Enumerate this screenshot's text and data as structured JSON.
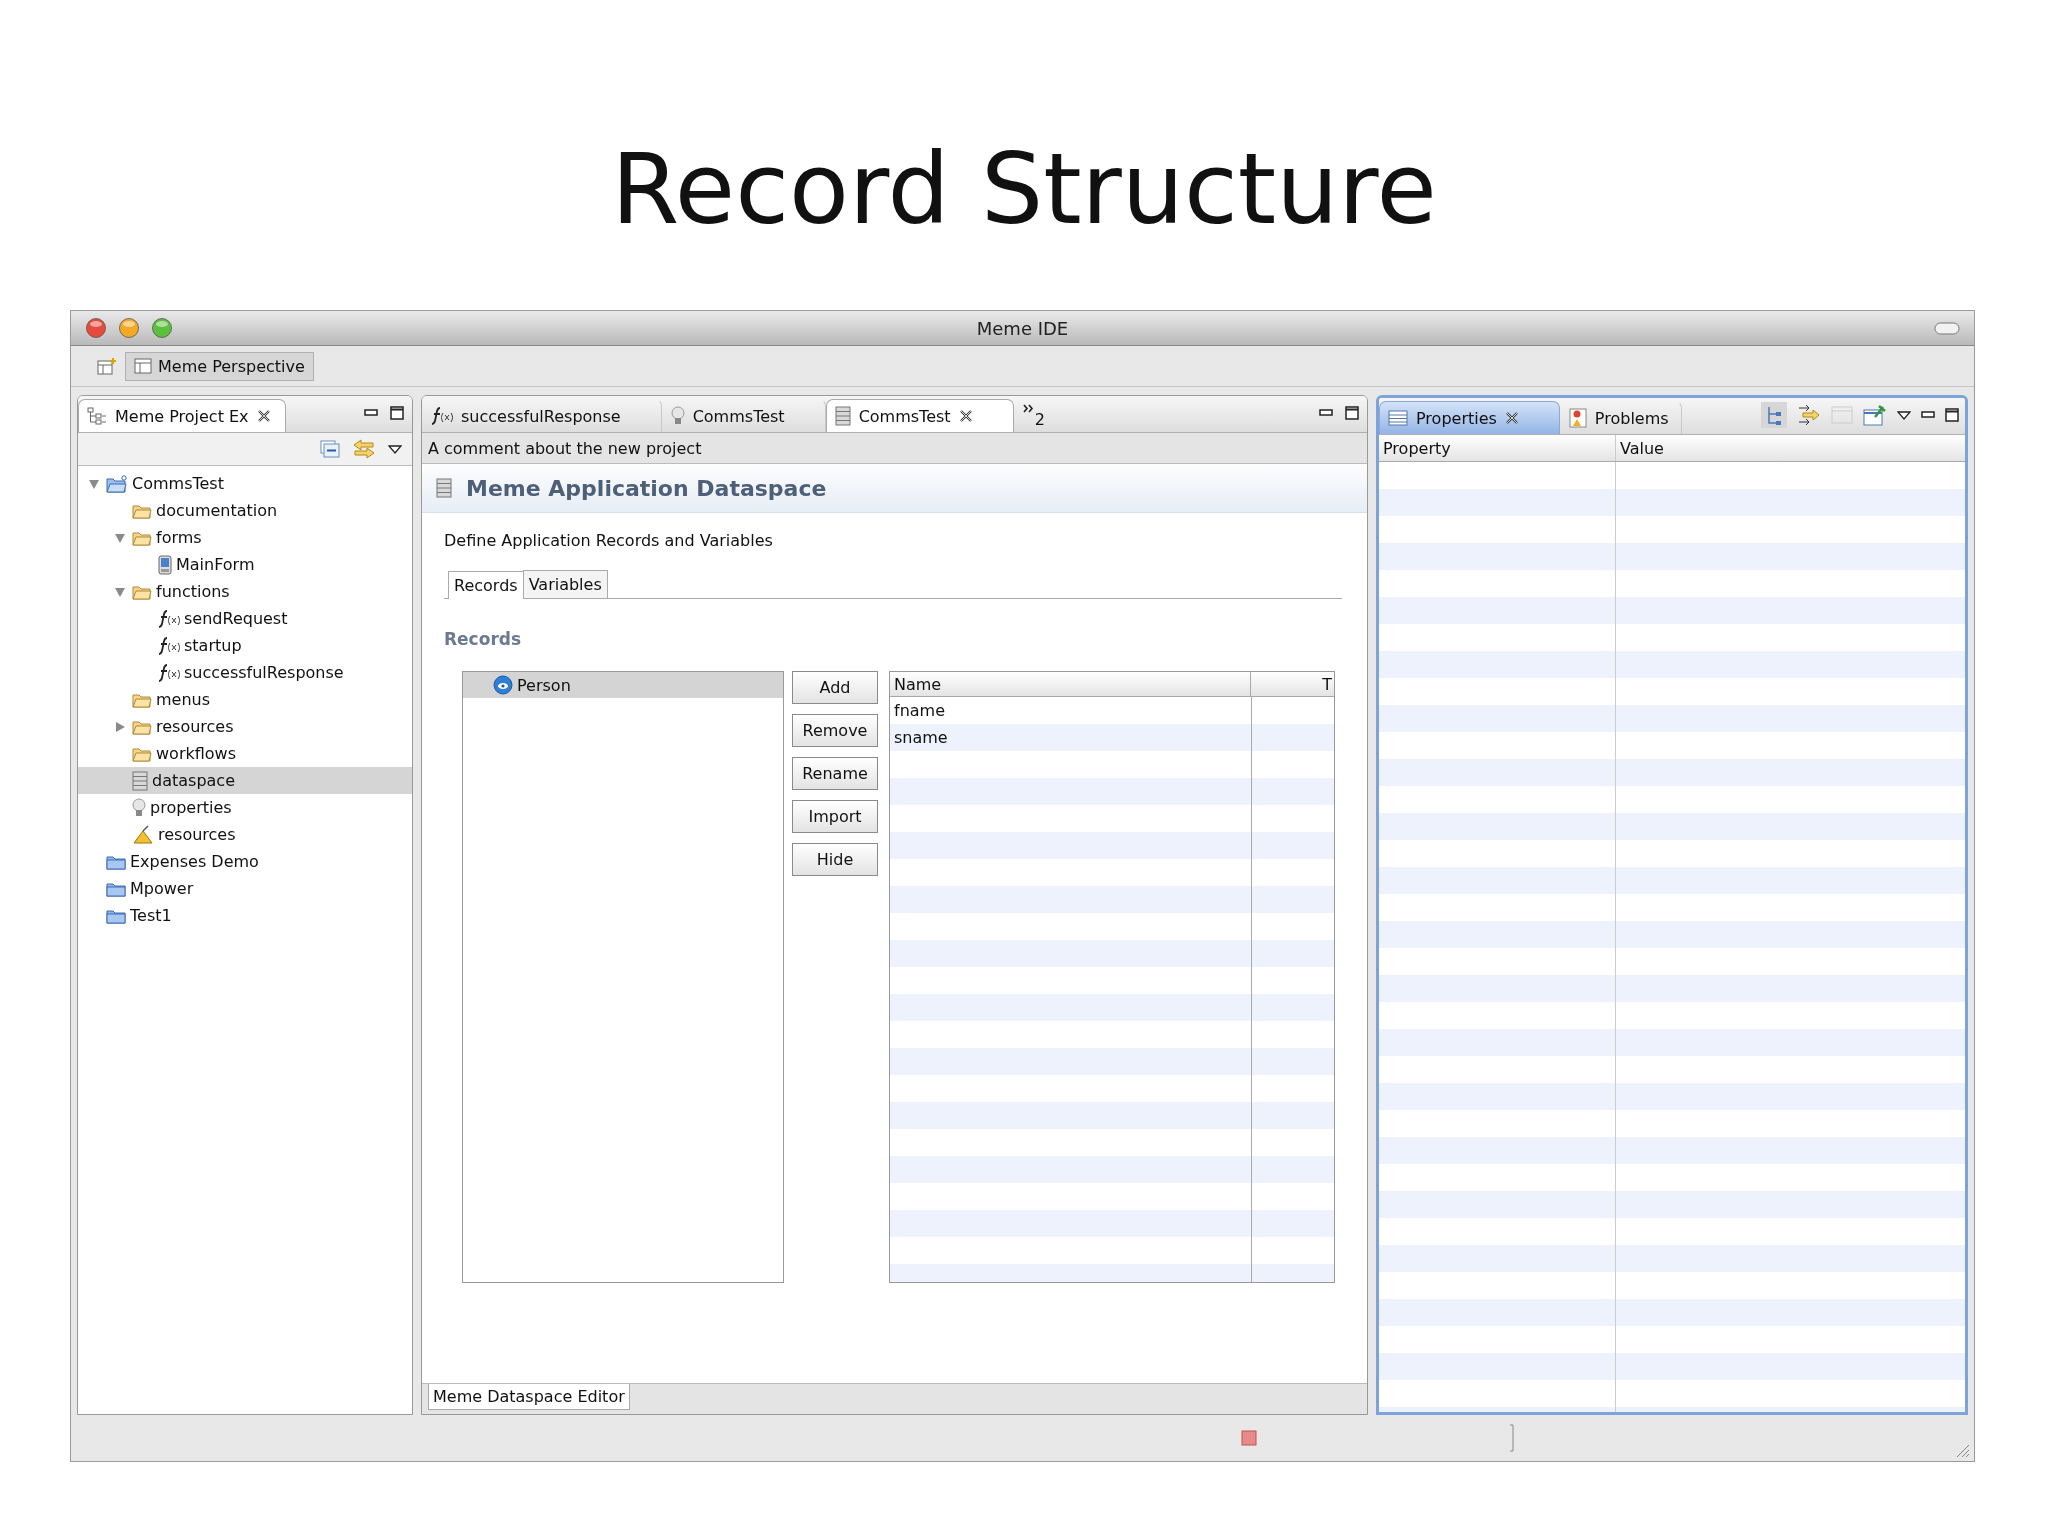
{
  "slide_title": "Record Structure",
  "window": {
    "title": "Meme IDE"
  },
  "perspectives": [
    {
      "label": "Meme Perspective",
      "selected": true
    }
  ],
  "project_explorer": {
    "title": "Meme Project Ex",
    "tree": [
      {
        "label": "CommsTest",
        "kind": "project",
        "expanded": true,
        "selected": false,
        "children": [
          {
            "label": "documentation",
            "kind": "folder",
            "selected": false
          },
          {
            "label": "forms",
            "kind": "folder",
            "expanded": true,
            "selected": false,
            "children": [
              {
                "label": "MainForm",
                "kind": "form",
                "selected": false
              }
            ]
          },
          {
            "label": "functions",
            "kind": "folder",
            "expanded": true,
            "selected": false,
            "children": [
              {
                "label": "sendRequest",
                "kind": "function",
                "selected": false
              },
              {
                "label": "startup",
                "kind": "function",
                "selected": false
              },
              {
                "label": "successfulResponse",
                "kind": "function",
                "selected": false
              }
            ]
          },
          {
            "label": "menus",
            "kind": "folder",
            "selected": false
          },
          {
            "label": "resources",
            "kind": "folder",
            "expanded": false,
            "selected": false
          },
          {
            "label": "workflows",
            "kind": "folder",
            "selected": false
          },
          {
            "label": "dataspace",
            "kind": "database",
            "selected": true
          },
          {
            "label": "properties",
            "kind": "bulb",
            "selected": false
          },
          {
            "label": "resources",
            "kind": "resources",
            "selected": false
          }
        ]
      },
      {
        "label": "Expenses Demo",
        "kind": "closed_project",
        "selected": false
      },
      {
        "label": "Mpower",
        "kind": "closed_project",
        "selected": false
      },
      {
        "label": "Test1",
        "kind": "closed_project",
        "selected": false
      }
    ]
  },
  "editor": {
    "tabs": [
      {
        "label": "successfulResponse",
        "kind": "function",
        "selected": false
      },
      {
        "label": "CommsTest",
        "kind": "bulb",
        "selected": false
      },
      {
        "label": "CommsTest",
        "kind": "database",
        "selected": true
      }
    ],
    "overflow_count": "2",
    "comment": "A comment about the new project",
    "form_title": "Meme Application Dataspace",
    "description": "Define Application Records and Variables",
    "subtabs": [
      {
        "label": "Records",
        "selected": true
      },
      {
        "label": "Variables",
        "selected": false
      }
    ],
    "section_label": "Records",
    "records": [
      {
        "label": "Person",
        "selected": true
      }
    ],
    "buttons": [
      "Add",
      "Remove",
      "Rename",
      "Import",
      "Hide"
    ],
    "fields": {
      "columns": [
        "Name",
        "T"
      ],
      "rows": [
        {
          "name": "fname"
        },
        {
          "name": "sname"
        }
      ]
    },
    "bottom_tabs": [
      {
        "label": "Meme Dataspace Editor",
        "selected": true
      }
    ]
  },
  "properties_view": {
    "tabs": [
      {
        "label": "Properties",
        "kind": "properties",
        "selected": true
      },
      {
        "label": "Problems",
        "kind": "problems",
        "selected": false
      }
    ],
    "columns": [
      "Property",
      "Value"
    ]
  }
}
